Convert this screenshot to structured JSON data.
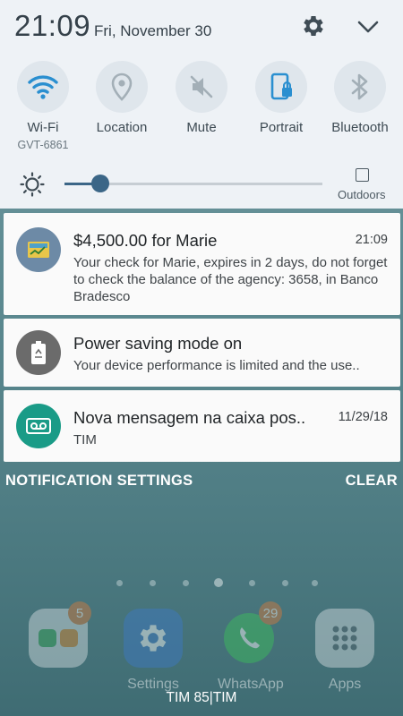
{
  "status": {
    "clock": "21:09",
    "date": "Fri, November 30"
  },
  "quick_toggles": [
    {
      "label": "Wi-Fi",
      "sub": "GVT-6861",
      "icon": "wifi-icon"
    },
    {
      "label": "Location",
      "sub": "",
      "icon": "location-icon"
    },
    {
      "label": "Mute",
      "sub": "",
      "icon": "mute-icon"
    },
    {
      "label": "Portrait",
      "sub": "",
      "icon": "portrait-lock-icon"
    },
    {
      "label": "Bluetooth",
      "sub": "",
      "icon": "bluetooth-icon"
    }
  ],
  "brightness": {
    "level": 0.14,
    "outdoors_label": "Outdoors"
  },
  "notifications": [
    {
      "title": "$4,500.00 for Marie",
      "time": "21:09",
      "body": "Your check for Marie, expires in 2 days, do not forget to check the balance of the agency: 3658, in Banco Bradesco",
      "icon": "check-app-icon",
      "icon_bg": "#6d8aa6"
    },
    {
      "title": "Power saving mode on",
      "time": "",
      "body": "Your device performance is limited and the use..",
      "icon": "battery-recycle-icon",
      "icon_bg": "#6b6b6b"
    },
    {
      "title": "Nova mensagem na caixa pos..",
      "time": "11/29/18",
      "body": "TIM",
      "icon": "voicemail-icon",
      "icon_bg": "#1a9b87"
    }
  ],
  "actions": {
    "settings_label": "NOTIFICATION SETTINGS",
    "clear_label": "CLEAR"
  },
  "home": {
    "apps": [
      {
        "name": "",
        "badge": "5",
        "icon": "folder-phone-contacts-icon"
      },
      {
        "name": "Settings",
        "badge": "",
        "icon": "settings-gear-icon"
      },
      {
        "name": "WhatsApp",
        "badge": "29",
        "icon": "whatsapp-icon"
      },
      {
        "name": "Apps",
        "badge": "",
        "icon": "apps-grid-icon"
      }
    ],
    "carrier": "TIM 85|TIM"
  },
  "colors": {
    "accent": "#3b6687",
    "panel_bg": "#eef2f6",
    "toggle_active": "#2a8fd0"
  }
}
